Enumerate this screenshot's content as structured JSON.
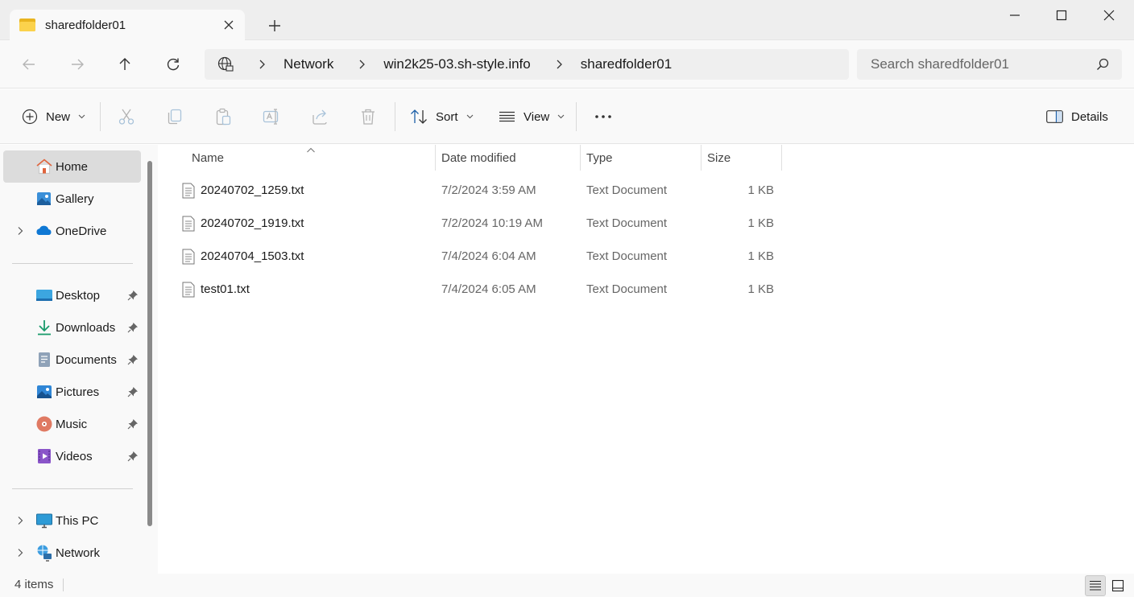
{
  "window": {
    "tab_title": "sharedfolder01"
  },
  "address": {
    "crumbs": [
      "Network",
      "win2k25-03.sh-style.info",
      "sharedfolder01"
    ]
  },
  "search": {
    "placeholder": "Search sharedfolder01"
  },
  "commandbar": {
    "new_label": "New",
    "sort_label": "Sort",
    "view_label": "View",
    "details_label": "Details"
  },
  "sidebar": {
    "items": [
      {
        "label": "Home",
        "icon": "home-icon"
      },
      {
        "label": "Gallery",
        "icon": "gallery-icon"
      },
      {
        "label": "OneDrive",
        "icon": "onedrive-icon"
      },
      {
        "label": "Desktop",
        "icon": "desktop-icon"
      },
      {
        "label": "Downloads",
        "icon": "downloads-icon"
      },
      {
        "label": "Documents",
        "icon": "documents-icon"
      },
      {
        "label": "Pictures",
        "icon": "pictures-icon"
      },
      {
        "label": "Music",
        "icon": "music-icon"
      },
      {
        "label": "Videos",
        "icon": "videos-icon"
      },
      {
        "label": "This PC",
        "icon": "this-pc-icon"
      },
      {
        "label": "Network",
        "icon": "network-icon"
      }
    ]
  },
  "table": {
    "headers": {
      "name": "Name",
      "date": "Date modified",
      "type": "Type",
      "size": "Size"
    },
    "rows": [
      {
        "name": "20240702_1259.txt",
        "date": "7/2/2024 3:59 AM",
        "type": "Text Document",
        "size": "1 KB"
      },
      {
        "name": "20240702_1919.txt",
        "date": "7/2/2024 10:19 AM",
        "type": "Text Document",
        "size": "1 KB"
      },
      {
        "name": "20240704_1503.txt",
        "date": "7/4/2024 6:04 AM",
        "type": "Text Document",
        "size": "1 KB"
      },
      {
        "name": "test01.txt",
        "date": "7/4/2024 6:05 AM",
        "type": "Text Document",
        "size": "1 KB"
      }
    ]
  },
  "status": {
    "item_count": "4 items"
  },
  "colors": {
    "accent": "#0067c0",
    "folder": "#fbd24c",
    "selected_bg": "#dcdcdc"
  }
}
